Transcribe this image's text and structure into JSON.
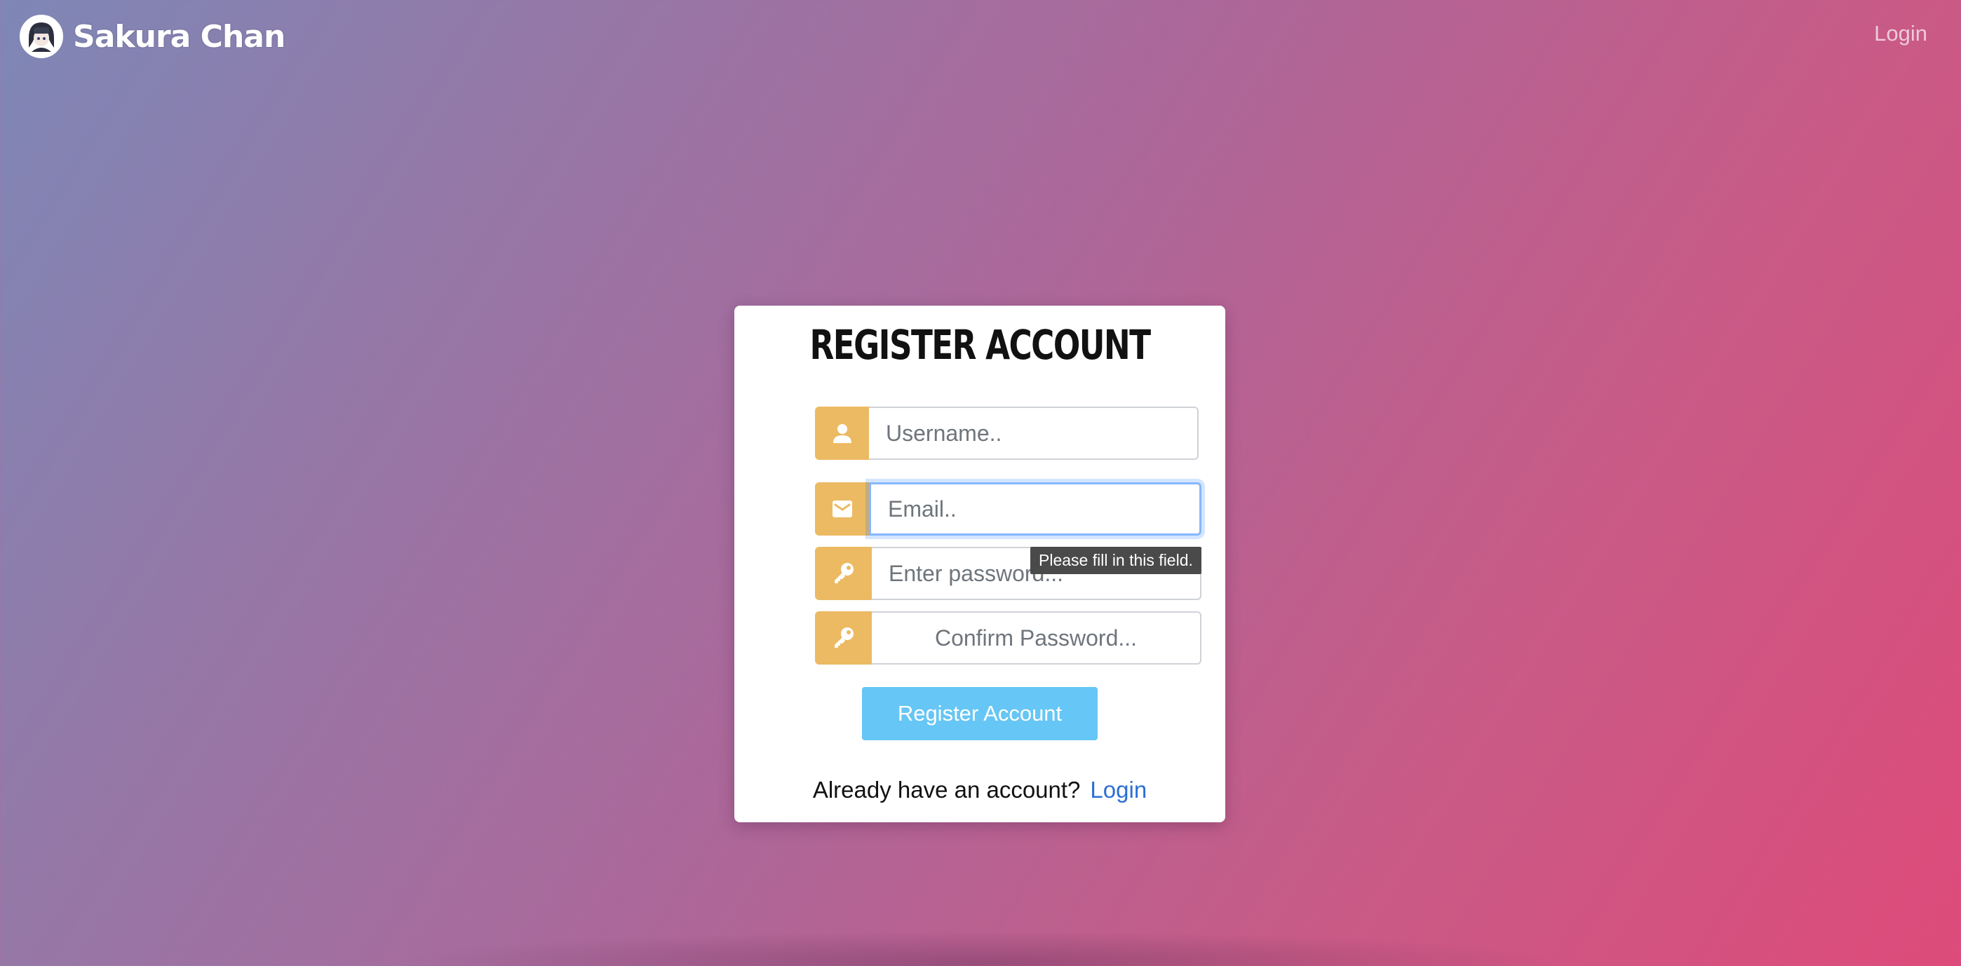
{
  "brand": {
    "name": "Sakura Chan",
    "logo_icon": "anime-avatar-icon"
  },
  "nav": {
    "login_label": "Login"
  },
  "form": {
    "title": "REGISTER ACCOUNT",
    "username": {
      "placeholder": "Username..",
      "value": "",
      "icon": "user-icon"
    },
    "email": {
      "placeholder": "Email..",
      "value": "",
      "icon": "envelope-icon",
      "focused": true
    },
    "password": {
      "placeholder": "Enter password...",
      "value": "",
      "icon": "key-icon"
    },
    "confirm_password": {
      "placeholder": "Confirm Password...",
      "value": "",
      "icon": "key-icon"
    },
    "validation_tooltip": "Please fill in this field.",
    "submit_label": "Register Account",
    "footer_text": "Already have an account?",
    "footer_link": "Login"
  },
  "colors": {
    "accent_addon": "#ecba63",
    "button": "#66c6f5",
    "link": "#2a6fd6"
  }
}
